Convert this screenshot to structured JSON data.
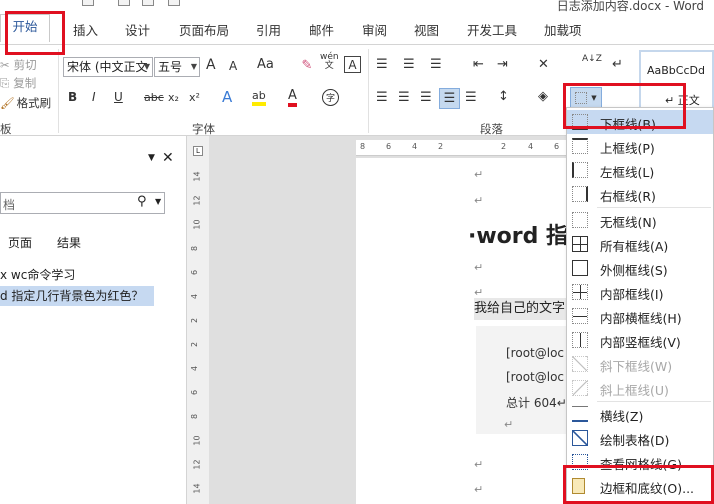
{
  "window": {
    "title": "日志添加内容.docx - Word"
  },
  "tabs": [
    "开始",
    "插入",
    "设计",
    "页面布局",
    "引用",
    "邮件",
    "审阅",
    "视图",
    "开发工具",
    "加载项"
  ],
  "clipboard": {
    "cut": "剪切",
    "copy": "复制",
    "format_painter": "格式刷",
    "group": "板"
  },
  "font": {
    "name": "宋体 (中文正文",
    "size": "五号",
    "group": "字体",
    "grow": "A",
    "shrink": "A",
    "case": "Aa",
    "wen": "wén",
    "wen2": "文",
    "char_border": "A",
    "bold": "B",
    "italic": "I",
    "underline": "U",
    "strike": "abc",
    "sub": "x₂",
    "sup": "x²",
    "effects": "A",
    "highlight": "ab",
    "color": "A",
    "circle": "字"
  },
  "paragraph": {
    "group": "段落",
    "sort": "A↓Z"
  },
  "styles": {
    "sample": "AaBbCcDd",
    "name": "↵ 正文"
  },
  "nav": {
    "search_placeholder": "档",
    "tabs": [
      "页面",
      "结果"
    ],
    "items": [
      "x wc命令学习",
      "d 指定几行背景色为红色？"
    ]
  },
  "ruler": {
    "h_ticks": [
      "8",
      "6",
      "4",
      "2",
      "2",
      "4",
      "6",
      "8"
    ],
    "v_ticks": [
      "14",
      "12",
      "10",
      "8",
      "6",
      "4",
      "2",
      "2",
      "4",
      "6",
      "8",
      "10",
      "12",
      "14",
      "16",
      "18"
    ]
  },
  "document": {
    "heading": "·word 指",
    "body_line": "我给自己的文字",
    "code1": "[root@loc",
    "code2": "[root@loc",
    "code3": "总计 604↵",
    "para_mark": "↵"
  },
  "menu": {
    "items": [
      {
        "label": "下框线(B)",
        "disabled": false
      },
      {
        "label": "上框线(P)",
        "disabled": false
      },
      {
        "label": "左框线(L)",
        "disabled": false
      },
      {
        "label": "右框线(R)",
        "disabled": false
      },
      {
        "label": "无框线(N)",
        "disabled": false
      },
      {
        "label": "所有框线(A)",
        "disabled": false
      },
      {
        "label": "外侧框线(S)",
        "disabled": false
      },
      {
        "label": "内部框线(I)",
        "disabled": false
      },
      {
        "label": "内部横框线(H)",
        "disabled": false
      },
      {
        "label": "内部竖框线(V)",
        "disabled": false
      },
      {
        "label": "斜下框线(W)",
        "disabled": true
      },
      {
        "label": "斜上框线(U)",
        "disabled": true
      },
      {
        "label": "横线(Z)",
        "disabled": false
      },
      {
        "label": "绘制表格(D)",
        "disabled": false
      },
      {
        "label": "查看网格线(G)",
        "disabled": false
      },
      {
        "label": "边框和底纹(O)...",
        "disabled": false
      }
    ]
  },
  "colors": {
    "accent": "#2b579a",
    "highlight": "#e01020",
    "selection": "#c6d9f1"
  }
}
